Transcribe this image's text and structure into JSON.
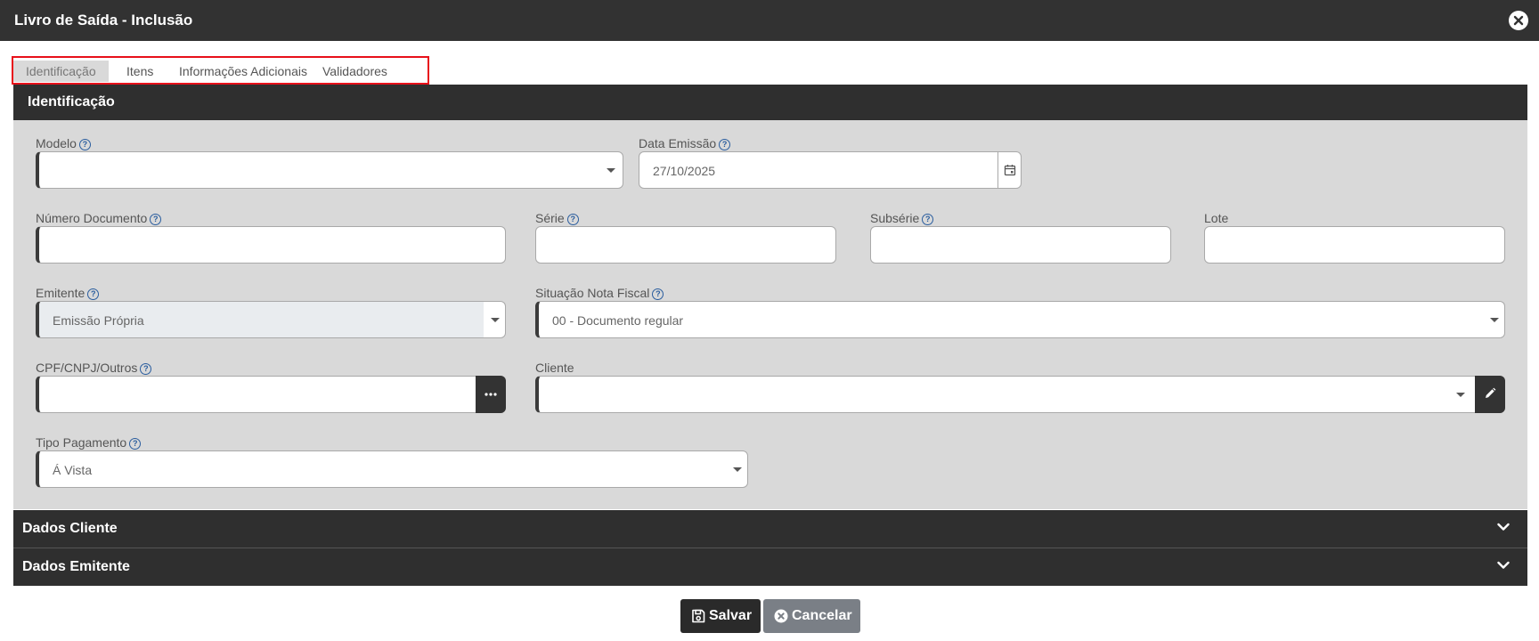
{
  "window": {
    "title": "Livro de Saída - Inclusão"
  },
  "tabs": [
    {
      "label": "Identificação",
      "active": true
    },
    {
      "label": "Itens",
      "active": false
    },
    {
      "label": "Informações Adicionais",
      "active": false
    },
    {
      "label": "Validadores",
      "active": false
    }
  ],
  "panel": {
    "title": "Identificação"
  },
  "help_glyph": "?",
  "fields": {
    "modelo": {
      "label": "Modelo",
      "value": ""
    },
    "data_emissao": {
      "label": "Data Emissão",
      "value": "27/10/2025"
    },
    "numero_documento": {
      "label": "Número Documento",
      "value": ""
    },
    "serie": {
      "label": "Série",
      "value": ""
    },
    "subserie": {
      "label": "Subsérie",
      "value": ""
    },
    "lote": {
      "label": "Lote",
      "value": ""
    },
    "emitente": {
      "label": "Emitente",
      "value": "Emissão Própria"
    },
    "situacao": {
      "label": "Situação Nota Fiscal",
      "value": "00 - Documento regular"
    },
    "cpf": {
      "label": "CPF/CNPJ/Outros",
      "value": ""
    },
    "cliente": {
      "label": "Cliente",
      "value": ""
    },
    "tipo_pagamento": {
      "label": "Tipo Pagamento",
      "value": "Á Vista"
    }
  },
  "sections": [
    {
      "title": "Dados Cliente"
    },
    {
      "title": "Dados Emitente"
    }
  ],
  "actions": {
    "save_label": "Salvar",
    "cancel_label": "Cancelar"
  },
  "icons": {
    "close": "close-icon",
    "help": "help-circle-icon",
    "calendar": "calendar-icon",
    "caret": "caret-down-icon",
    "ellipsis": "ellipsis-icon",
    "pencil": "pencil-icon",
    "chevron": "chevron-down-icon",
    "save": "floppy-disk-icon",
    "cancel": "times-circle-icon"
  }
}
